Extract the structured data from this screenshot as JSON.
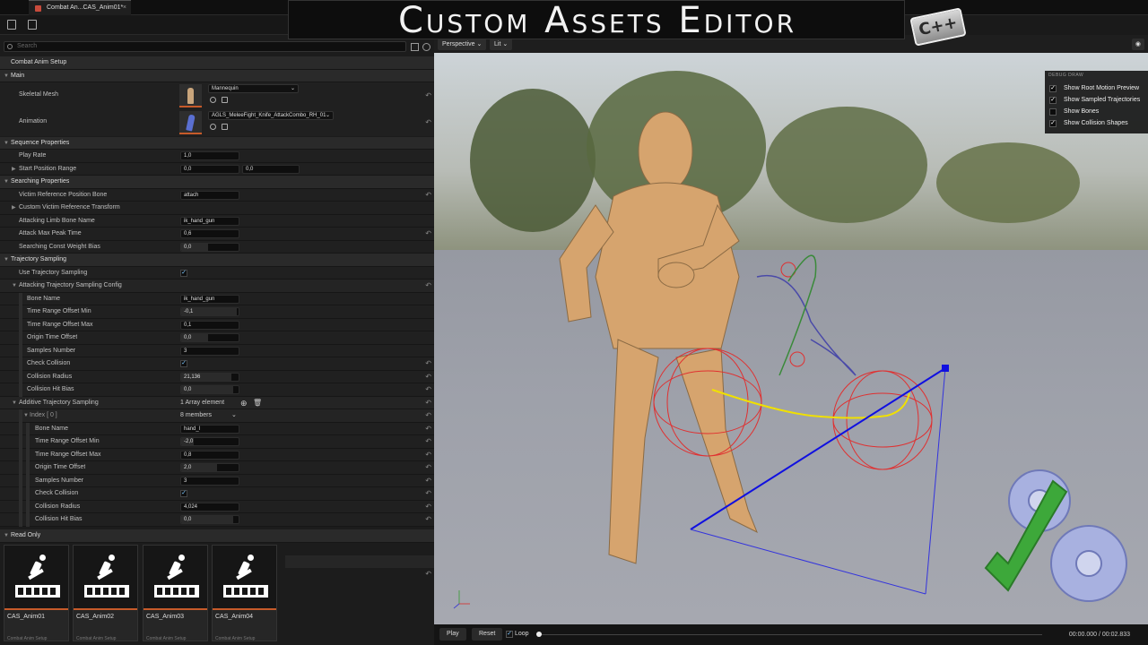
{
  "tab": {
    "title": "Combat An...CAS_Anim01*"
  },
  "banner": {
    "title": "Custom Assets Editor",
    "badge": "C++"
  },
  "details": {
    "search_placeholder": "Search",
    "root_category": "Combat Anim Setup",
    "main": {
      "label": "Main",
      "skeletal_mesh_label": "Skeletal Mesh",
      "skeletal_mesh_value": "Mannequin",
      "animation_label": "Animation",
      "animation_value": "AGLS_MeleeFight_Knife_AttackCombo_RH_01"
    },
    "sequence": {
      "label": "Sequence Properties",
      "play_rate_label": "Play Rate",
      "play_rate": "1,0",
      "start_range_label": "Start Position Range",
      "start_range_a": "0,0",
      "start_range_b": "0,0"
    },
    "searching": {
      "label": "Searching Properties",
      "victim_bone_label": "Victim Reference Position Bone",
      "victim_bone": "attach",
      "custom_victim_label": "Custom Victim Reference Transform",
      "limb_bone_label": "Attacking Limb Bone Name",
      "limb_bone": "ik_hand_gun",
      "peak_time_label": "Attack Max Peak Time",
      "peak_time": "0,6",
      "weight_bias_label": "Searching Const Weight Bias",
      "weight_bias": "0,0",
      "weight_bias_fill": 0.0
    },
    "trajectory": {
      "label": "Trajectory Sampling",
      "use_label": "Use Trajectory Sampling",
      "use_checked": true,
      "config_label": "Attacking Trajectory Sampling Config",
      "bone_name_label": "Bone Name",
      "bone_name": "ik_hand_gun",
      "min_label": "Time Range Offset Min",
      "min_value": "-0,1",
      "max_label": "Time Range Offset Max",
      "max_value": "0,1",
      "origin_label": "Origin Time Offset",
      "origin_value": "0,0",
      "samples_label": "Samples Number",
      "samples_value": "3",
      "check_label": "Check Collision",
      "check_checked": true,
      "radius_label": "Collision Radius",
      "radius_value": "21,136",
      "hitbias_label": "Collision Hit Bias",
      "hitbias_value": "0,0"
    },
    "additive": {
      "label": "Additive Trajectory Sampling",
      "array_count": "1 Array element",
      "index_label": "Index [ 0 ]",
      "members": "8 members",
      "bone_name_label": "Bone Name",
      "bone_name": "hand_l",
      "min_label": "Time Range Offset Min",
      "min_value": "-2,0",
      "max_label": "Time Range Offset Max",
      "max_value": "0,8",
      "origin_label": "Origin Time Offset",
      "origin_value": "2,0",
      "samples_label": "Samples Number",
      "samples_value": "3",
      "check_label": "Check Collision",
      "check_checked": true,
      "radius_label": "Collision Radius",
      "radius_value": "4,024",
      "hitbias_label": "Collision Hit Bias",
      "hitbias_value": "0,0"
    },
    "read_only": {
      "label": "Read Only",
      "cards": [
        {
          "name": "CAS_Anim01",
          "type": "Combat Anim Setup"
        },
        {
          "name": "CAS_Anim02",
          "type": "Combat Anim Setup"
        },
        {
          "name": "CAS_Anim03",
          "type": "Combat Anim Setup"
        },
        {
          "name": "CAS_Anim04",
          "type": "Combat Anim Setup"
        }
      ]
    }
  },
  "viewport": {
    "perspective": "Perspective",
    "lit": "Lit",
    "debug": {
      "header": "DEBUG DRAW",
      "options": [
        {
          "label": "Show Root Motion Preview",
          "checked": true
        },
        {
          "label": "Show Sampled Trajectories",
          "checked": true
        },
        {
          "label": "Show Bones",
          "checked": false
        },
        {
          "label": "Show Collision Shapes",
          "checked": true
        }
      ]
    },
    "timeline": {
      "play": "Play",
      "reset": "Reset",
      "loop": "Loop",
      "loop_checked": true,
      "time": "00:00.000 / 00:02.833",
      "progress": 0.0
    }
  },
  "colors": {
    "accent_orange": "#c65a2a",
    "check_blue": "#7cc6ff",
    "trajectory_blue": "#1010e0",
    "trajectory_yellow": "#f0e000",
    "collision_red": "#e03030",
    "gear_blue": "#9ea9dc",
    "check_green": "#3da83a"
  },
  "icons": {
    "save": "save-icon",
    "browse": "browse-icon",
    "search": "search-icon",
    "reset": "reset-arrow-icon",
    "settings": "gear-icon"
  }
}
